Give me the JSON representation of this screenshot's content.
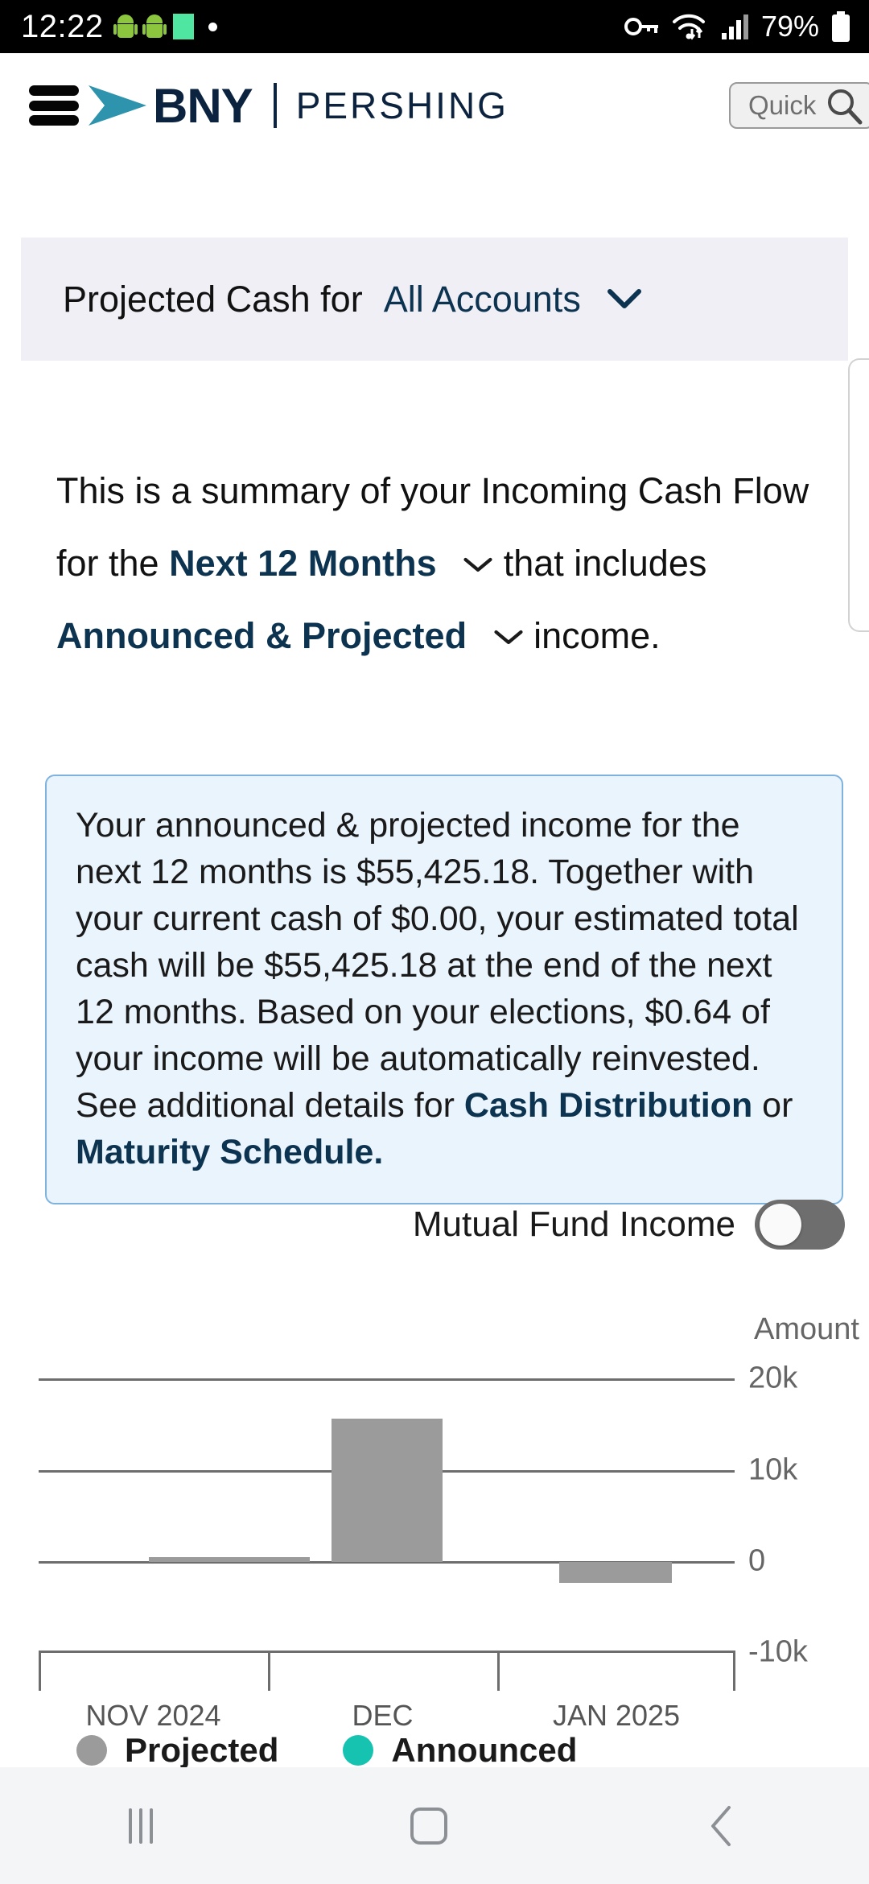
{
  "status_bar": {
    "time": "12:22",
    "battery_percent": "79%",
    "icons": [
      "android-robot-icon",
      "android-robot-icon",
      "green-sheet-icon",
      "white-dot-icon",
      "vpn-key-icon",
      "wifi-icon",
      "cellular-signal-icon",
      "battery-icon"
    ]
  },
  "header": {
    "menu_icon": "hamburger-menu-icon",
    "brand": "BNY",
    "brand_suffix": "PERSHING",
    "search_placeholder": "Quick",
    "search_value": "",
    "search_icon": "search-icon"
  },
  "account_bar": {
    "label": "Projected Cash for",
    "selected_account": "All Accounts",
    "chevron_icon": "chevron-down-icon"
  },
  "summary": {
    "line1": "This is a summary of your Incoming Cash Flow",
    "line2_prefix": "for the",
    "period": "Next 12 Months",
    "line2_suffix": "that includes",
    "income_type": "Announced & Projected",
    "line3_suffix": "income."
  },
  "callout": {
    "text_part1": "Your announced & projected income for the next 12 months is $55,425.18. Together with your current cash of $0.00, your estimated total cash will be $55,425.18 at the end of the next 12 months. Based on your elections, $0.64 of your income will be automatically reinvested. See additional details for ",
    "link1": "Cash Distribution",
    "conjunction": " or ",
    "link2": "Maturity Schedule.",
    "values": {
      "projected_income": "$55,425.18",
      "current_cash": "$0.00",
      "estimated_total_cash": "$55,425.18",
      "reinvested": "$0.64",
      "period": "next 12 months"
    }
  },
  "toggle": {
    "label": "Mutual Fund Income",
    "state": "off"
  },
  "chart_data": {
    "type": "bar",
    "title": "",
    "ylabel": "Amount",
    "xlabel": "",
    "categories": [
      "NOV 2024",
      "DEC",
      "JAN 2025"
    ],
    "series": [
      {
        "name": "Projected",
        "color": "#9b9b9b",
        "values": [
          100,
          15600,
          -3200
        ]
      }
    ],
    "yticks": [
      "20k",
      "10k",
      "0",
      "-10k"
    ],
    "ylim": [
      -10000,
      20000
    ],
    "grid": true,
    "legend": [
      {
        "label": "Projected",
        "color": "#9b9b9b"
      },
      {
        "label": "Announced",
        "color": "#16c3b0"
      }
    ],
    "legend_position": "bottom"
  },
  "nav_bar": {
    "recents_icon": "recents-icon",
    "home_icon": "home-icon",
    "back_icon": "back-chevron-icon"
  }
}
